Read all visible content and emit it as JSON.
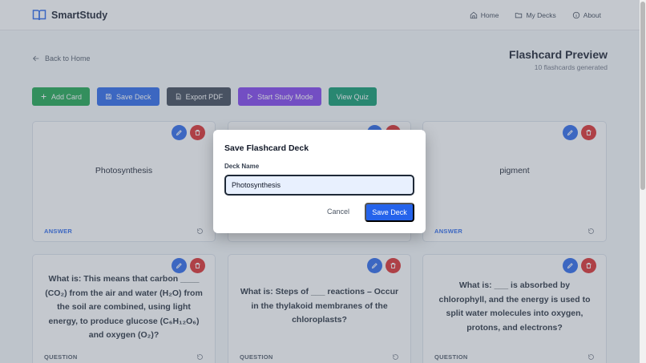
{
  "nav": {
    "brand": "SmartStudy",
    "links": [
      {
        "label": "Home",
        "icon": "home-icon"
      },
      {
        "label": "My Decks",
        "icon": "folder-icon"
      },
      {
        "label": "About",
        "icon": "info-icon"
      }
    ]
  },
  "page": {
    "back_label": "Back to Home",
    "title": "Flashcard Preview",
    "subtitle": "10 flashcards generated"
  },
  "actions": {
    "add": "Add Card",
    "save": "Save Deck",
    "export": "Export PDF",
    "study": "Start Study Mode",
    "quiz": "View Quiz"
  },
  "cards": [
    {
      "text": "Photosynthesis",
      "tag": "ANSWER"
    },
    {
      "text": "",
      "tag": ""
    },
    {
      "text": "pigment",
      "tag": "ANSWER"
    },
    {
      "text": "What is: This means that carbon ____ (CO₂) from the air and water (H₂O) from the soil are combined, using light energy, to produce glucose (C₆H₁₂O₆) and oxygen (O₂)?",
      "tag": "QUESTION"
    },
    {
      "text": "What is: Steps of ___ reactions – Occur in the thylakoid membranes of the chloroplasts?",
      "tag": "QUESTION"
    },
    {
      "text": "What is: ___ is absorbed by chlorophyll, and the energy is used to split water molecules into oxygen, protons, and electrons?",
      "tag": "QUESTION"
    }
  ],
  "modal": {
    "title": "Save Flashcard Deck",
    "label": "Deck Name",
    "value": "Photosynthesis",
    "cancel": "Cancel",
    "save": "Save Deck"
  },
  "colors": {
    "primary": "#2563eb",
    "success": "#16a34a",
    "danger": "#dc2626",
    "purple": "#7c3aed"
  }
}
